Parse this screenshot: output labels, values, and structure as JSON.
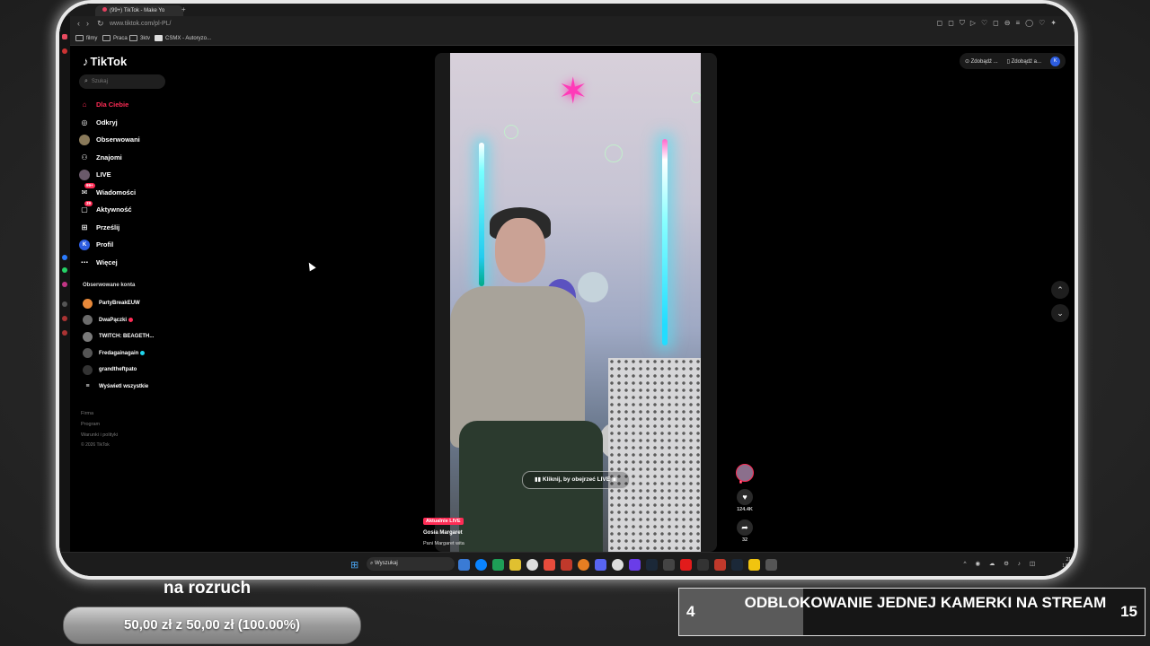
{
  "browser": {
    "tab_title": "(99+) TikTok - Make Yo",
    "url": "www.tiktok.com/pl-PL/",
    "bookmarks": [
      "filmy",
      "Praca",
      "3ktv",
      "CSMX - Autoryzo..."
    ]
  },
  "tiktok": {
    "logo": "TikTok",
    "search_placeholder": "Szukaj",
    "nav": [
      {
        "label": "Dla Ciebie",
        "icon": "home-icon",
        "active": true
      },
      {
        "label": "Odkryj",
        "icon": "compass-icon"
      },
      {
        "label": "Obserwowani",
        "icon": "following-avatar"
      },
      {
        "label": "Znajomi",
        "icon": "friends-icon"
      },
      {
        "label": "LIVE",
        "icon": "live-avatar"
      },
      {
        "label": "Wiadomości",
        "icon": "messages-icon",
        "badge": "99+"
      },
      {
        "label": "Aktywność",
        "icon": "activity-icon",
        "badge": "39"
      },
      {
        "label": "Prześlij",
        "icon": "upload-icon"
      },
      {
        "label": "Profil",
        "icon": "profile-avatar",
        "avatar_letter": "K"
      },
      {
        "label": "Więcej",
        "icon": "more-icon"
      }
    ],
    "followed_title": "Obserwowane konta",
    "followed": [
      {
        "name": "PartyBreakEUW",
        "color": "#e8893a"
      },
      {
        "name": "DwaPączki",
        "color": "#6b6b6b",
        "live": true
      },
      {
        "name": "TWITCH: BEAGETH...",
        "color": "#7a7a7a"
      },
      {
        "name": "Fredagainagain",
        "color": "#555555",
        "verified": true
      },
      {
        "name": "grandtheftpato",
        "color": "#333333"
      },
      {
        "name": "Wyświetl wszystkie",
        "color": "#000000",
        "is_all": true
      }
    ],
    "footer": {
      "links": [
        "Firma",
        "Program",
        "Warunki i polityki"
      ],
      "copyright": "© 2026 TikTok"
    },
    "video": {
      "live_prompt": "Kliknij, by obejrzeć LIVE",
      "live_badge": "Aktualnie LIVE",
      "creator": "Gosia Margaret",
      "description": "Pani Margaret wita",
      "likes": "124.4K",
      "shares": "32"
    },
    "top_right": {
      "btn1": "Zdobądź ...",
      "btn2": "Zdobądź a...",
      "avatar_letter": "K"
    }
  },
  "taskbar": {
    "search_placeholder": "Wyszukaj",
    "time": "21",
    "date": "17.0"
  },
  "overlay": {
    "goal_label": "na rozruch",
    "goal_text": "50,00 zł  z  50,00 zł (100.00%)",
    "goal_progress": 1.0,
    "unlock_current": "4",
    "unlock_title": "ODBLOKOWANIE JEDNEJ KAMERKI NA STREAM",
    "unlock_max": "15",
    "unlock_progress": 0.267
  },
  "colors": {
    "tiktok_red": "#fe2c55",
    "live_cyan": "#20d5ec"
  }
}
